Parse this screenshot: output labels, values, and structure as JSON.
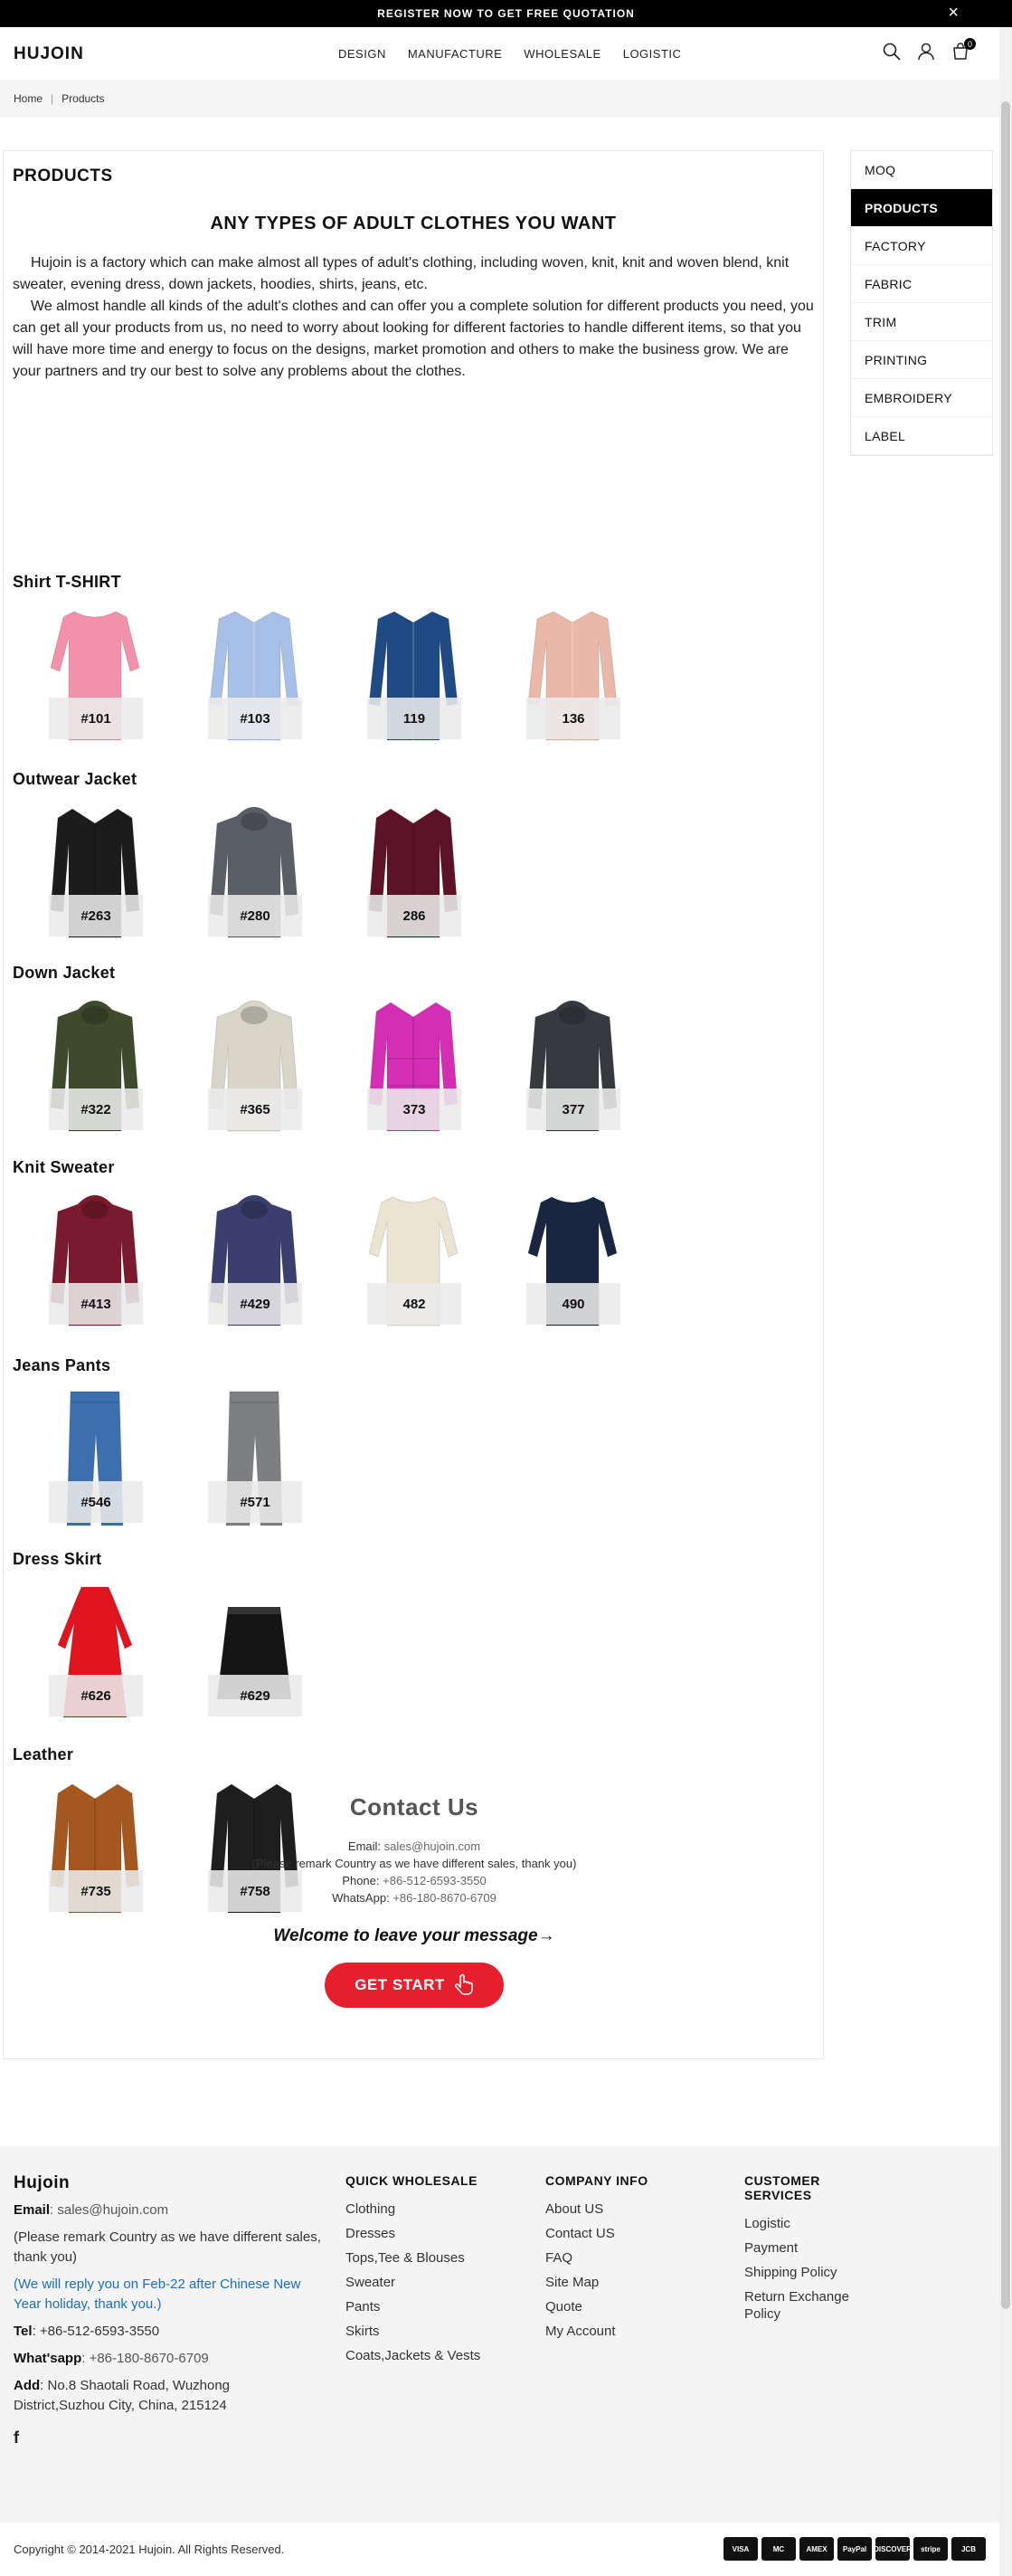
{
  "announcement": {
    "text": "REGISTER NOW TO GET FREE QUOTATION",
    "close_icon": "×"
  },
  "header": {
    "logo": "HUJOIN",
    "nav": [
      "DESIGN",
      "MANUFACTURE",
      "WHOLESALE",
      "LOGISTIC"
    ],
    "cart_count": "0",
    "icons": [
      "search-icon",
      "account-icon",
      "cart-icon"
    ]
  },
  "breadcrumb": {
    "home": "Home",
    "separator": "|",
    "current": "Products"
  },
  "page": {
    "title": "PRODUCTS",
    "headline": "ANY TYPES OF ADULT CLOTHES YOU WANT",
    "intro_p1": "Hujoin is a factory which can make almost all types of adult's clothing, including woven, knit, knit and woven blend, knit sweater, evening dress, down jackets, hoodies, shirts, jeans, etc.",
    "intro_p2": "We almost handle all kinds of the adult's clothes and can offer you a complete solution for different products you need, you can get all your products from us, no need to worry about looking for different factories to handle different items, so that you will have more time and energy to focus on the designs, market promotion and others to make the business grow. We are your partners and try our best to solve any problems about the clothes."
  },
  "categories": [
    {
      "title": "Shirt T-SHIRT",
      "items": [
        {
          "label": "#101",
          "kind": "tee",
          "color": "#f291a9"
        },
        {
          "label": "#103",
          "kind": "shirt",
          "color": "#a8c0e8"
        },
        {
          "label": "119",
          "kind": "shirt",
          "color": "#1f4a84"
        },
        {
          "label": "136",
          "kind": "blouse",
          "color": "#e9b8a8"
        }
      ]
    },
    {
      "title": "Outwear Jacket",
      "items": [
        {
          "label": "#263",
          "kind": "jacket",
          "color": "#1c1c1c"
        },
        {
          "label": "#280",
          "kind": "hood",
          "color": "#5a5e66"
        },
        {
          "label": "286",
          "kind": "jacket",
          "color": "#5c1227"
        }
      ]
    },
    {
      "title": "Down Jacket",
      "items": [
        {
          "label": "#322",
          "kind": "parka",
          "color": "#3f4a2c"
        },
        {
          "label": "#365",
          "kind": "parka",
          "color": "#d9d6c9"
        },
        {
          "label": "373",
          "kind": "puffer",
          "color": "#d42fb4"
        },
        {
          "label": "377",
          "kind": "parka",
          "color": "#363a3f"
        }
      ]
    },
    {
      "title": "Knit Sweater",
      "items": [
        {
          "label": "#413",
          "kind": "hood",
          "color": "#7a1a2e"
        },
        {
          "label": "#429",
          "kind": "hood",
          "color": "#3a3f6e"
        },
        {
          "label": "482",
          "kind": "sweater",
          "color": "#ece4d3"
        },
        {
          "label": "490",
          "kind": "sweater",
          "color": "#1a2540"
        }
      ]
    },
    {
      "title": "Jeans Pants",
      "items": [
        {
          "label": "#546",
          "kind": "jeans",
          "color": "#3d6fb0"
        },
        {
          "label": "#571",
          "kind": "jeans",
          "color": "#7d7f82"
        }
      ]
    },
    {
      "title": "Dress Skirt",
      "items": [
        {
          "label": "#626",
          "kind": "dress",
          "color": "#e0141f"
        },
        {
          "label": "#629",
          "kind": "skirt",
          "color": "#151515"
        }
      ]
    },
    {
      "title": "Leather",
      "items": [
        {
          "label": "#735",
          "kind": "jacket",
          "color": "#a4581f"
        },
        {
          "label": "#758",
          "kind": "jacket",
          "color": "#1e1e1e"
        }
      ]
    }
  ],
  "contact": {
    "title": "Contact Us",
    "email_label": "Email:",
    "email": "sales@hujoin.com",
    "remark": "(Please remark Country as we have different sales, thank you)",
    "phone_label": "Phone:",
    "phone": "+86-512-6593-3550",
    "whatsapp_label": "WhatsApp:",
    "whatsapp": "+86-180-8670-6709",
    "welcome": "Welcome to leave your message→",
    "button": "GET START"
  },
  "sidebar": {
    "items": [
      "MOQ",
      "PRODUCTS",
      "FACTORY",
      "FABRIC",
      "TRIM",
      "PRINTING",
      "EMBROIDERY",
      "LABEL"
    ],
    "active": "PRODUCTS"
  },
  "footer": {
    "brand": {
      "title": "Hujoin",
      "email_label": "Email",
      "email": ": sales@hujoin.com",
      "remark": "(Please remark Country as we have different sales, thank you)",
      "notice": "(We will reply you on Feb-22 after Chinese New Year holiday, thank you.)",
      "tel_label": "Tel",
      "tel": ": +86-512-6593-3550",
      "whatsapp_label": "What'sapp",
      "whatsapp": ": +86-180-8670-6709",
      "add_label": "Add",
      "address": ": No.8 Shaotali Road, Wuzhong District,Suzhou City, China, 215124",
      "facebook": "f"
    },
    "quick_wholesale": {
      "title": "QUICK WHOLESALE",
      "links": [
        "Clothing",
        "Dresses",
        "Tops,Tee & Blouses",
        "Sweater",
        "Pants",
        "Skirts",
        "Coats,Jackets & Vests"
      ]
    },
    "company_info": {
      "title": "COMPANY INFO",
      "links": [
        "About US",
        "Contact US",
        "FAQ",
        "Site Map",
        "Quote",
        "My Account"
      ]
    },
    "customer_services": {
      "title": "CUSTOMER SERVICES",
      "links": [
        "Logistic",
        "Payment",
        "Shipping Policy",
        "Return Exchange Policy"
      ]
    }
  },
  "bottom": {
    "copyright": "Copyright © 2014-2021 Hujoin. All Rights Reserved.",
    "payments": [
      "VISA",
      "MC",
      "AMEX",
      "PayPal",
      "DISCOVER",
      "stripe",
      "JCB"
    ]
  }
}
